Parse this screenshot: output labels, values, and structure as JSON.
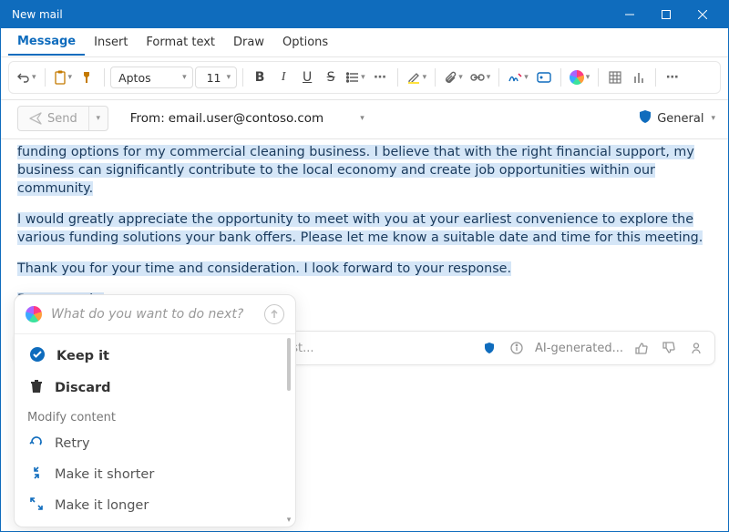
{
  "window": {
    "title": "New mail"
  },
  "tabs": [
    "Message",
    "Insert",
    "Format text",
    "Draw",
    "Options"
  ],
  "active_tab": 0,
  "toolbar": {
    "font_name": "Aptos",
    "font_size": "11"
  },
  "header": {
    "send_label": "Send",
    "from_label": "From:",
    "from_value": "email.user@contoso.com",
    "sensitivity_label": "General"
  },
  "body": {
    "p1": "funding options for my commercial cleaning business. I believe that with the right financial support, my business can significantly contribute to the local economy and create job opportunities within our community.",
    "p2": "I would greatly appreciate the opportunity to meet with you at your earliest convenience to explore the various funding solutions your bank offers. Please let me know a suitable date and time for this meeting.",
    "p3": "Thank you for your time and consideration. I look forward to your response.",
    "signoff": "Best regards,"
  },
  "prompt_bar": {
    "placeholder": "Write an email to a bank manager request...",
    "status": "AI-generated..."
  },
  "copilot_panel": {
    "prompt": "What do you want to do next?",
    "keep": "Keep it",
    "discard": "Discard",
    "modify_label": "Modify content",
    "retry": "Retry",
    "shorter": "Make it shorter",
    "longer": "Make it longer"
  }
}
